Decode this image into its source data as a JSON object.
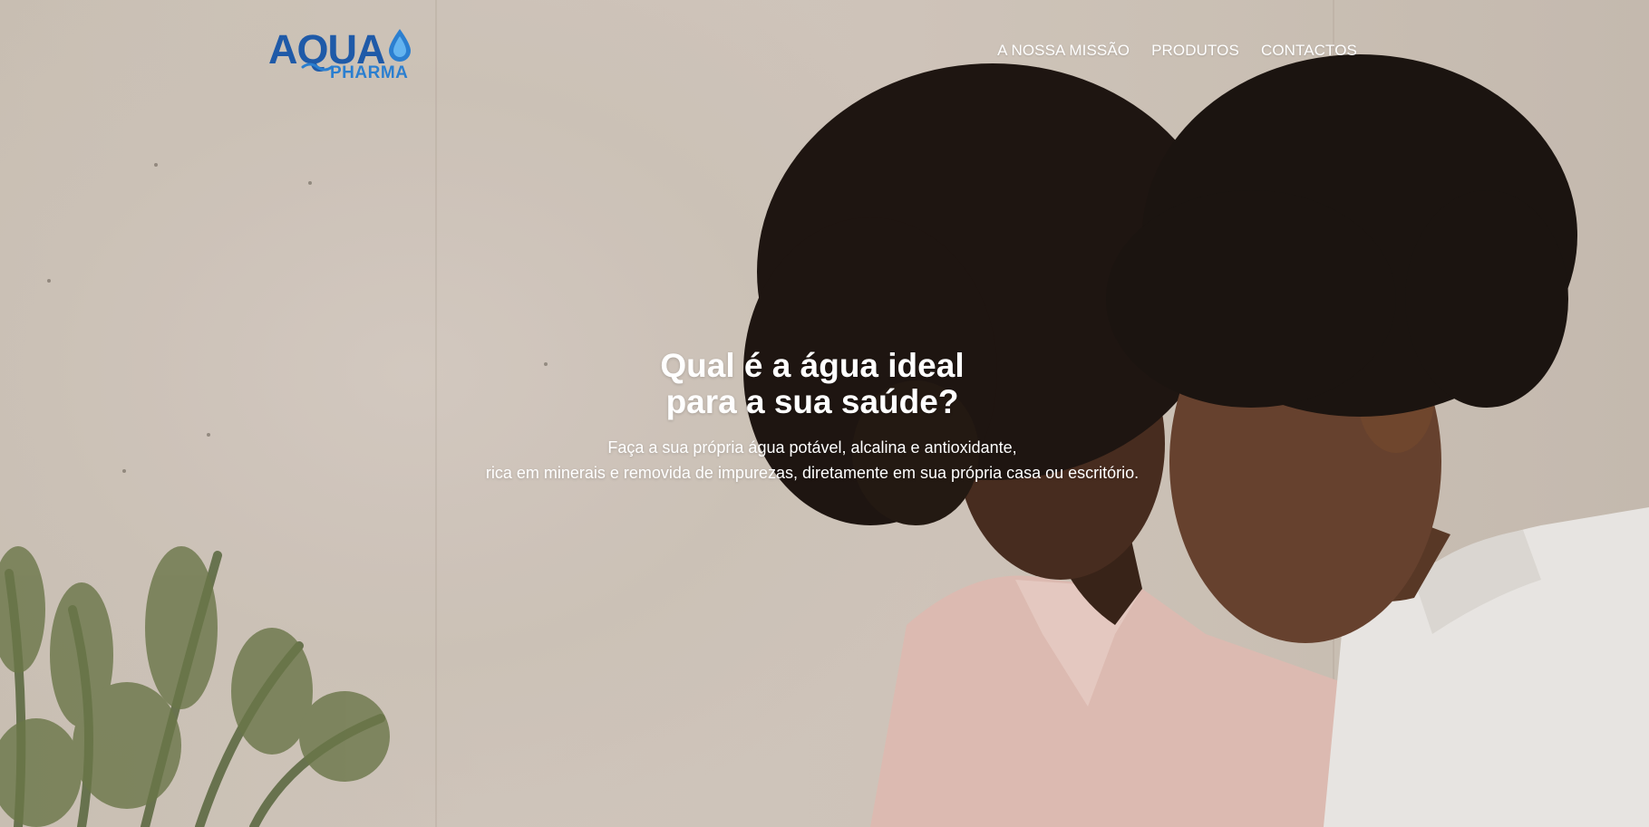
{
  "brand": {
    "name_top": "AQUA",
    "name_bottom": "PHARMA",
    "primary_color": "#1f5aa8",
    "secondary_color": "#2b7fd0",
    "icon": "water-drop-icon"
  },
  "nav": {
    "items": [
      {
        "label": "A NOSSA MISSÃO"
      },
      {
        "label": "PRODUTOS"
      },
      {
        "label": "CONTACTOS"
      }
    ]
  },
  "hero": {
    "title_line1": "Qual é a água ideal",
    "title_line2": "para a sua saúde?",
    "subtitle_line1": "Faça a sua própria água potável, alcalina e antioxidante,",
    "subtitle_line2": "rica em minerais e removida de impurezas, diretamente em sua própria casa ou escritório.",
    "text_color": "#ffffff"
  }
}
